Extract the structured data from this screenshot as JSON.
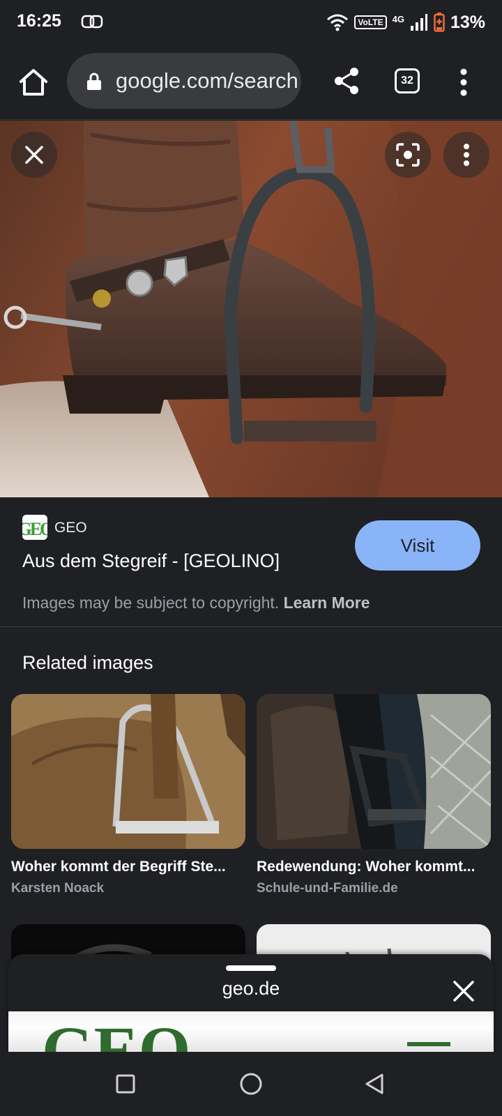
{
  "status_bar": {
    "time": "16:25",
    "volte": "VoLTE",
    "network": "4G",
    "battery": "13%",
    "icons": [
      "link-icon",
      "wifi-icon",
      "signal-icon",
      "battery-low-icon"
    ]
  },
  "browser": {
    "url": "google.com/search",
    "tab_count": "32",
    "icons": [
      "home-icon",
      "lock-icon",
      "share-icon",
      "tabs-icon",
      "more-vert-icon"
    ]
  },
  "viewer": {
    "icons": [
      "close-icon",
      "lens-icon",
      "more-vert-icon"
    ]
  },
  "result": {
    "source": "GEO",
    "favicon_text": "GEO",
    "title": "Aus dem Stegreif - [GEOLINO]",
    "visit_label": "Visit",
    "copyright": "Images may be subject to copyright.",
    "learn_more": "Learn More"
  },
  "related": {
    "heading": "Related images",
    "items": [
      {
        "title": "Woher kommt der Begriff Ste...",
        "source": "Karsten Noack"
      },
      {
        "title": "Redewendung: Woher kommt...",
        "source": "Schule-und-Familie.de"
      }
    ]
  },
  "sheet": {
    "domain": "geo.de",
    "preview_logo": "GEO"
  },
  "colors": {
    "background": "#1f2023",
    "accent": "#8ab4f8",
    "battery_low": "#f26b3a"
  }
}
